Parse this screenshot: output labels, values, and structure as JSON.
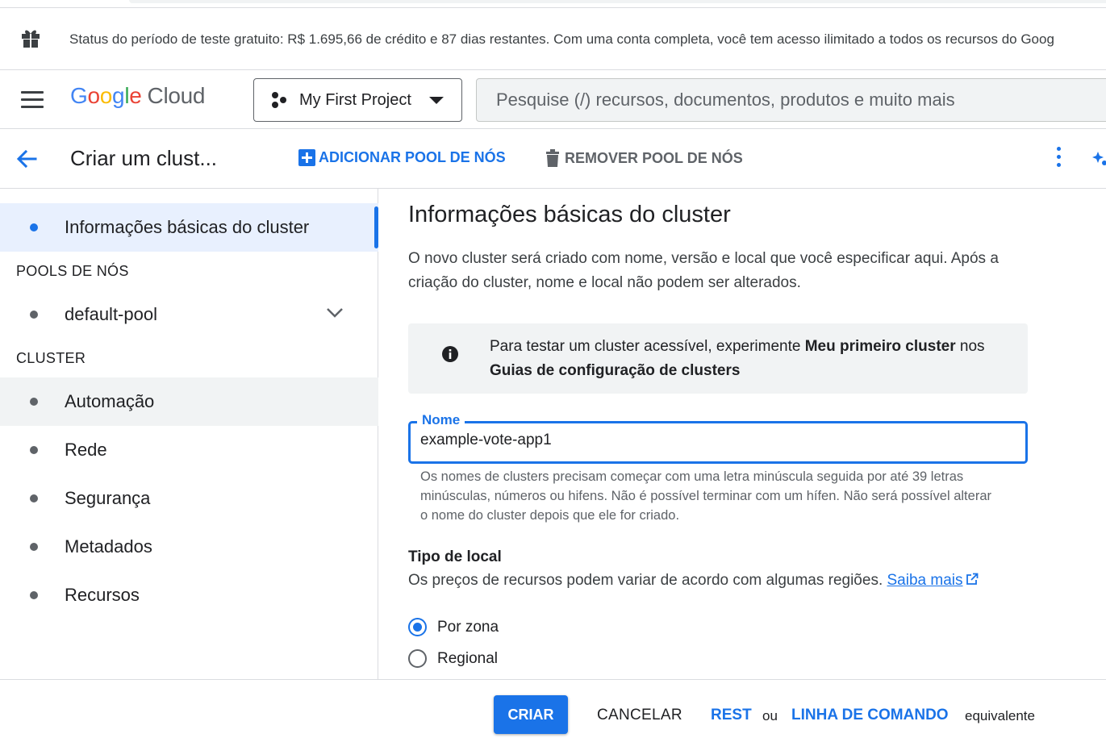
{
  "trial_banner": {
    "icon": "gift-icon",
    "text": "Status do período de teste gratuito: R$ 1.695,66 de crédito e 87 dias restantes. Com uma conta completa, você tem acesso ilimitado a todos os recursos do Goog"
  },
  "header": {
    "logo_letters": [
      "G",
      "o",
      "o",
      "g",
      "l",
      "e"
    ],
    "logo_product": "Cloud",
    "project_label": "My First Project",
    "search_placeholder": "Pesquise (/) recursos, documentos, produtos e muito mais"
  },
  "toolbar": {
    "title": "Criar um clust...",
    "add_pool_label": "ADICIONAR POOL DE NÓS",
    "remove_pool_label": "REMOVER POOL DE NÓS"
  },
  "sidebar": {
    "active_item": "Informações básicas do cluster",
    "section_pools": "POOLS DE NÓS",
    "pool_item": "default-pool",
    "section_cluster": "CLUSTER",
    "cluster_items": [
      "Automação",
      "Rede",
      "Segurança",
      "Metadados",
      "Recursos"
    ]
  },
  "main": {
    "heading": "Informações básicas do cluster",
    "intro": "O novo cluster será criado com nome, versão e local que você especificar aqui. Após a criação do cluster, nome e local não podem ser alterados.",
    "info": {
      "prefix": "Para testar um cluster acessível, experimente ",
      "bold1": "Meu primeiro cluster",
      "middle": " nos ",
      "bold2": "Guias de configuração de clusters"
    },
    "name_field": {
      "label": "Nome",
      "value": "example-vote-app1",
      "helper": "Os nomes de clusters precisam começar com uma letra minúscula seguida por até 39 letras minúsculas, números ou hifens. Não é possível terminar com um hífen. Não será possível alterar o nome do cluster depois que ele for criado."
    },
    "location": {
      "title": "Tipo de local",
      "description": "Os preços de recursos podem variar de acordo com algumas regiões. ",
      "link": "Saiba mais",
      "options": [
        "Por zona",
        "Regional"
      ],
      "selected": "Por zona"
    }
  },
  "footer": {
    "create_label": "CRIAR",
    "cancel_label": "CANCELAR",
    "rest_label": "REST",
    "or_label": "ou",
    "cli_label": "LINHA DE COMANDO",
    "equivalent_label": "equivalente"
  },
  "colors": {
    "accent": "#1a73e8",
    "active_nav_bg": "#e8f0fe",
    "info_bg": "#f1f3f4"
  }
}
